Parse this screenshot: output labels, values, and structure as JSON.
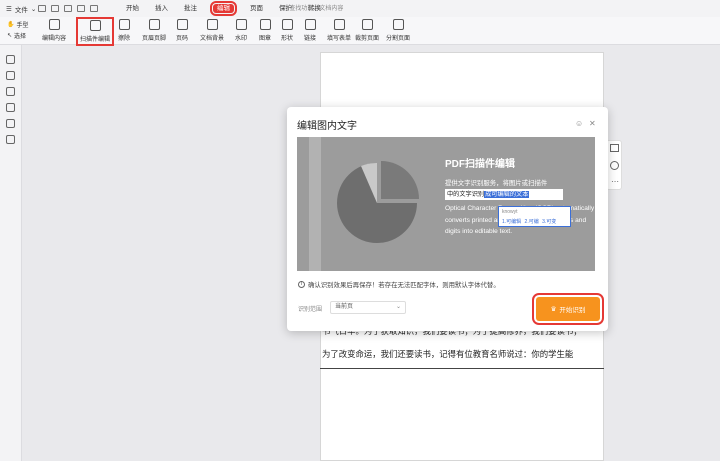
{
  "menubar": {
    "file_label": "文件",
    "tabs": [
      "开始",
      "插入",
      "批注",
      "编辑",
      "页面",
      "保护",
      "转换"
    ],
    "active_tab": "编辑",
    "search_placeholder": "查找功能、文档内容"
  },
  "ribbon": {
    "mode_hand": "手型",
    "mode_select": "选择",
    "tools": [
      "编辑内容",
      "扫描件编辑",
      "擦除",
      "页眉页脚",
      "页码",
      "文档背景",
      "水印",
      "图章",
      "形状",
      "链接",
      "填写表单",
      "裁剪页面",
      "分割页面"
    ]
  },
  "document": {
    "lines": [
      "书气日华。为了获取知识，我们要读书；为了提高修养，我们要读书；",
      "为了改变命运，我们还要读书，记得有位教育名师说过：你的学生能"
    ]
  },
  "modal": {
    "title": "编辑图内文字",
    "banner_title": "PDF扫描件编辑",
    "banner_desc": "提供文字识别服务，将图片或扫描件",
    "banner_selected_prefix": "中的文字识别",
    "banner_selected_highlight": "成可编辑的文本",
    "banner_english": "Optical Character Recognition (OCR) automatically converts printed and handwritten characters and digits into editable text.",
    "popup_word": "knowyt",
    "popup_options": "1.可编辑  2.可编  3.可变",
    "note": "确认识别效果后再保存！若存在无法匹配字体，则用默认字体代替。",
    "range_label": "识别范围",
    "range_value": "当前页",
    "start_label": "开始识别",
    "accent_color": "#f7931e",
    "highlight_color": "#e53935"
  }
}
